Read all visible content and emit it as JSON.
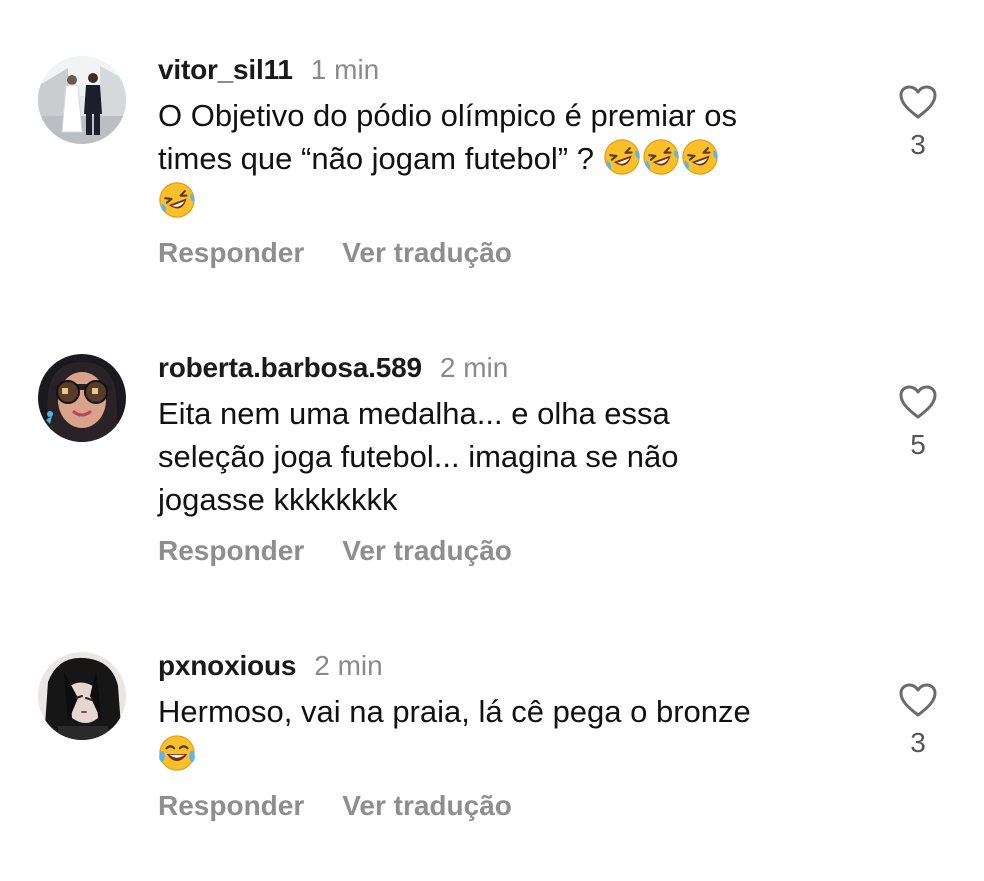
{
  "comments": [
    {
      "username": "vitor_sil11",
      "time": "1 min",
      "text_line1": "O Objetivo do pódio olímpico é premiar os",
      "text_line2": "times que “não jogam futebol” ? ",
      "emojis_line2": [
        "rolling-on-floor-laughing",
        "rolling-on-floor-laughing",
        "rolling-on-floor-laughing"
      ],
      "emojis_line3": [
        "rolling-on-floor-laughing"
      ],
      "reply_label": "Responder",
      "translate_label": "Ver tradução",
      "likes": "3",
      "like_icon": "heart-outline-icon"
    },
    {
      "username": "roberta.barbosa.589",
      "time": "2 min",
      "text_line1": "Eita nem uma medalha... e olha essa",
      "text_line2": "seleção joga futebol... imagina se não",
      "text_line3": "jogasse kkkkkkkk",
      "reply_label": "Responder",
      "translate_label": "Ver tradução",
      "likes": "5",
      "like_icon": "heart-outline-icon"
    },
    {
      "username": "pxnoxious",
      "time": "2 min",
      "text_line1": "Hermoso, vai na praia, lá cê pega o bronze",
      "emojis_line2": [
        "face-with-tears-of-joy"
      ],
      "reply_label": "Responder",
      "translate_label": "Ver tradução",
      "likes": "3",
      "like_icon": "heart-outline-icon"
    }
  ],
  "colors": {
    "username": "#1a1a1a",
    "secondary": "#8e8e8e",
    "emoji_yellow": "#f9c02a"
  }
}
